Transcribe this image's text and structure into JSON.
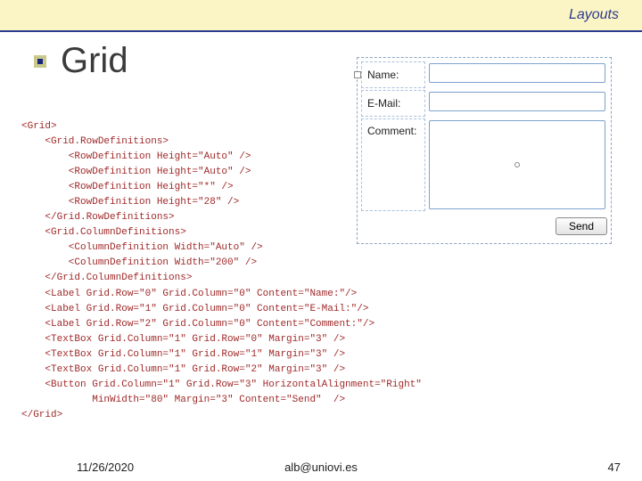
{
  "breadcrumb": "Layouts",
  "title": "Grid",
  "code": [
    "<Grid>",
    "    <Grid.RowDefinitions>",
    "        <RowDefinition Height=\"Auto\" />",
    "        <RowDefinition Height=\"Auto\" />",
    "        <RowDefinition Height=\"*\" />",
    "        <RowDefinition Height=\"28\" />",
    "    </Grid.RowDefinitions>",
    "    <Grid.ColumnDefinitions>",
    "        <ColumnDefinition Width=\"Auto\" />",
    "        <ColumnDefinition Width=\"200\" />",
    "    </Grid.ColumnDefinitions>",
    "    <Label Grid.Row=\"0\" Grid.Column=\"0\" Content=\"Name:\"/>",
    "    <Label Grid.Row=\"1\" Grid.Column=\"0\" Content=\"E-Mail:\"/>",
    "    <Label Grid.Row=\"2\" Grid.Column=\"0\" Content=\"Comment:\"/>",
    "    <TextBox Grid.Column=\"1\" Grid.Row=\"0\" Margin=\"3\" />",
    "    <TextBox Grid.Column=\"1\" Grid.Row=\"1\" Margin=\"3\" />",
    "    <TextBox Grid.Column=\"1\" Grid.Row=\"2\" Margin=\"3\" />",
    "    <Button Grid.Column=\"1\" Grid.Row=\"3\" HorizontalAlignment=\"Right\"",
    "            MinWidth=\"80\" Margin=\"3\" Content=\"Send\"  />",
    "</Grid>"
  ],
  "form": {
    "labels": {
      "name": "Name:",
      "email": "E-Mail:",
      "comment": "Comment:"
    },
    "button": "Send"
  },
  "footer": {
    "date": "11/26/2020",
    "email": "alb@uniovi.es",
    "page": "47"
  }
}
